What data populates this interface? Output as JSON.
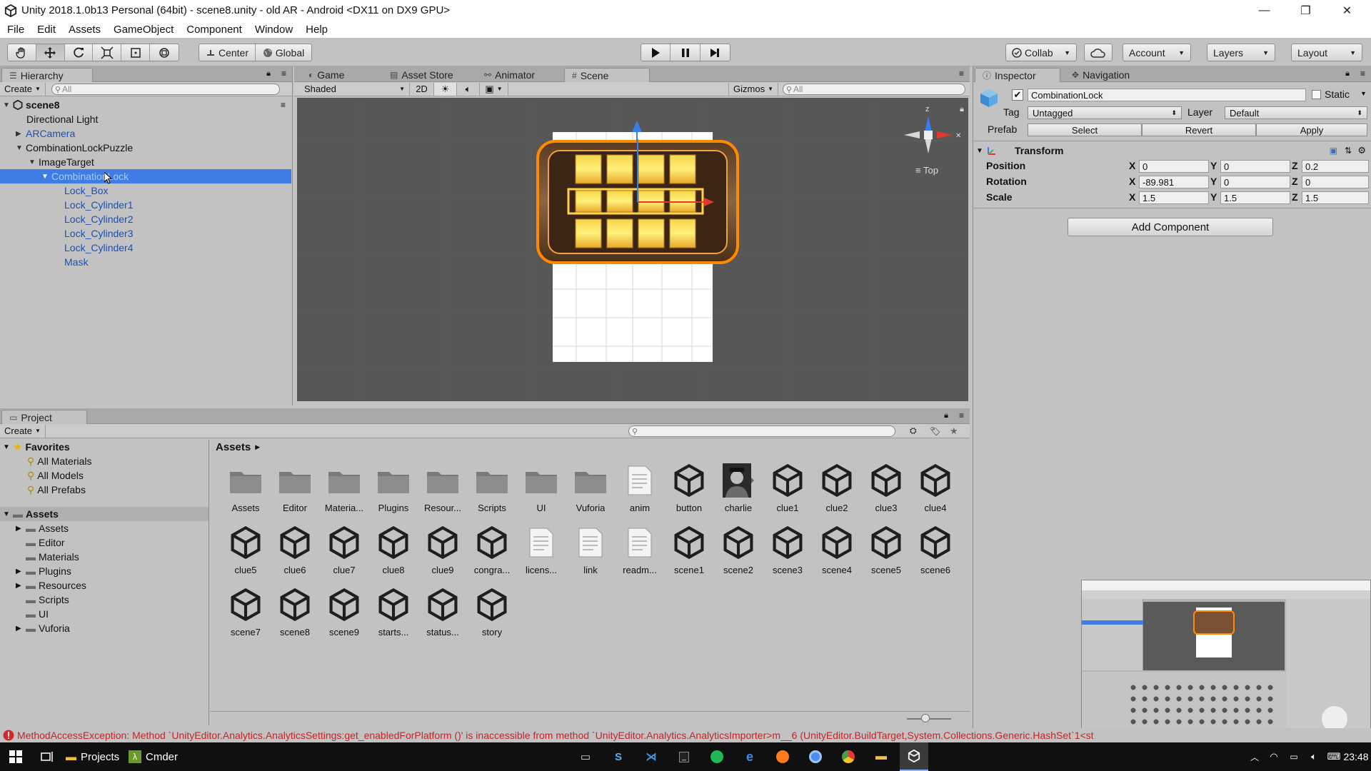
{
  "window": {
    "title": "Unity 2018.1.0b13 Personal (64bit) - scene8.unity - old AR - Android <DX11 on DX9 GPU>",
    "minimize": "—",
    "maximize": "❐",
    "close": "✕"
  },
  "menu": [
    "File",
    "Edit",
    "Assets",
    "GameObject",
    "Component",
    "Window",
    "Help"
  ],
  "toolbar": {
    "pivot_label": "Center",
    "space_label": "Global",
    "collab_label": "Collab",
    "account_label": "Account",
    "layers_label": "Layers",
    "layout_label": "Layout"
  },
  "hierarchy": {
    "tab_label": "Hierarchy",
    "create_label": "Create",
    "search_placeholder": "All",
    "scene_name": "scene8",
    "items": [
      {
        "label": "Directional Light"
      },
      {
        "label": "ARCamera"
      },
      {
        "label": "CombinationLockPuzzle"
      },
      {
        "label": "ImageTarget"
      },
      {
        "label": "CombinationLock"
      },
      {
        "label": "Lock_Box"
      },
      {
        "label": "Lock_Cylinder1"
      },
      {
        "label": "Lock_Cylinder2"
      },
      {
        "label": "Lock_Cylinder3"
      },
      {
        "label": "Lock_Cylinder4"
      },
      {
        "label": "Mask"
      }
    ]
  },
  "scene": {
    "tabs": [
      {
        "label": "Game"
      },
      {
        "label": "Asset Store"
      },
      {
        "label": "Animator"
      },
      {
        "label": "Scene"
      }
    ],
    "shading_label": "Shaded",
    "mode_2d_label": "2D",
    "gizmos_label": "Gizmos",
    "search_placeholder": "All",
    "gizmo_axis_label": "z",
    "view_label": "Top"
  },
  "inspector": {
    "tab_label": "Inspector",
    "nav_tab_label": "Navigation",
    "object_name": "CombinationLock",
    "static_label": "Static",
    "tag_label": "Tag",
    "tag_value": "Untagged",
    "layer_label": "Layer",
    "layer_value": "Default",
    "prefab_label": "Prefab",
    "select_label": "Select",
    "revert_label": "Revert",
    "apply_label": "Apply",
    "transform_label": "Transform",
    "position_label": "Position",
    "rotation_label": "Rotation",
    "scale_label": "Scale",
    "axis_x": "X",
    "axis_y": "Y",
    "axis_z": "Z",
    "position": {
      "x": "0",
      "y": "0",
      "z": "0.2"
    },
    "rotation": {
      "x": "-89.981",
      "y": "0",
      "z": "0"
    },
    "scale": {
      "x": "1.5",
      "y": "1.5",
      "z": "1.5"
    },
    "add_component_label": "Add Component"
  },
  "project": {
    "tab_label": "Project",
    "create_label": "Create",
    "favorites_label": "Favorites",
    "favorites": [
      "All Materials",
      "All Models",
      "All Prefabs"
    ],
    "assets_root_label": "Assets",
    "folders": [
      "Assets",
      "Editor",
      "Materials",
      "Plugins",
      "Resources",
      "Scripts",
      "UI",
      "Vuforia"
    ],
    "breadcrumb": "Assets",
    "assets": [
      {
        "label": "Assets",
        "kind": "folder"
      },
      {
        "label": "Editor",
        "kind": "folder"
      },
      {
        "label": "Materia...",
        "kind": "folder"
      },
      {
        "label": "Plugins",
        "kind": "folder"
      },
      {
        "label": "Resour...",
        "kind": "folder"
      },
      {
        "label": "Scripts",
        "kind": "folder"
      },
      {
        "label": "UI",
        "kind": "folder"
      },
      {
        "label": "Vuforia",
        "kind": "folder"
      },
      {
        "label": "anim",
        "kind": "doc"
      },
      {
        "label": "button",
        "kind": "unity"
      },
      {
        "label": "charlie",
        "kind": "image"
      },
      {
        "label": "clue1",
        "kind": "unity"
      },
      {
        "label": "clue2",
        "kind": "unity"
      },
      {
        "label": "clue3",
        "kind": "unity"
      },
      {
        "label": "clue4",
        "kind": "unity"
      },
      {
        "label": "clue5",
        "kind": "unity"
      },
      {
        "label": "clue6",
        "kind": "unity"
      },
      {
        "label": "clue7",
        "kind": "unity"
      },
      {
        "label": "clue8",
        "kind": "unity"
      },
      {
        "label": "clue9",
        "kind": "unity"
      },
      {
        "label": "congra...",
        "kind": "unity"
      },
      {
        "label": "licens...",
        "kind": "doc"
      },
      {
        "label": "link",
        "kind": "doc"
      },
      {
        "label": "readm...",
        "kind": "doc"
      },
      {
        "label": "scene1",
        "kind": "unity"
      },
      {
        "label": "scene2",
        "kind": "unity"
      },
      {
        "label": "scene3",
        "kind": "unity"
      },
      {
        "label": "scene4",
        "kind": "unity"
      },
      {
        "label": "scene5",
        "kind": "unity"
      },
      {
        "label": "scene6",
        "kind": "unity"
      },
      {
        "label": "scene7",
        "kind": "unity"
      },
      {
        "label": "scene8",
        "kind": "unity"
      },
      {
        "label": "scene9",
        "kind": "unity"
      },
      {
        "label": "starts...",
        "kind": "unity"
      },
      {
        "label": "status...",
        "kind": "unity"
      },
      {
        "label": "story",
        "kind": "unity"
      }
    ]
  },
  "console": {
    "message": "MethodAccessException: Method `UnityEditor.Analytics.AnalyticsSettings:get_enabledForPlatform ()' is inaccessible from method `UnityEditor.Analytics.AnalyticsImporter>m__6 (UnityEditor.BuildTarget,System.Collections.Generic.HashSet`1<st"
  },
  "taskbar": {
    "projects_label": "Projects",
    "cmder_label": "Cmder",
    "time": "23:48"
  },
  "colors": {
    "selection": "#3e7de3",
    "error": "#c0262b",
    "link_blue": "#1b4fb3",
    "editor_bg": "#c2c2c2"
  }
}
